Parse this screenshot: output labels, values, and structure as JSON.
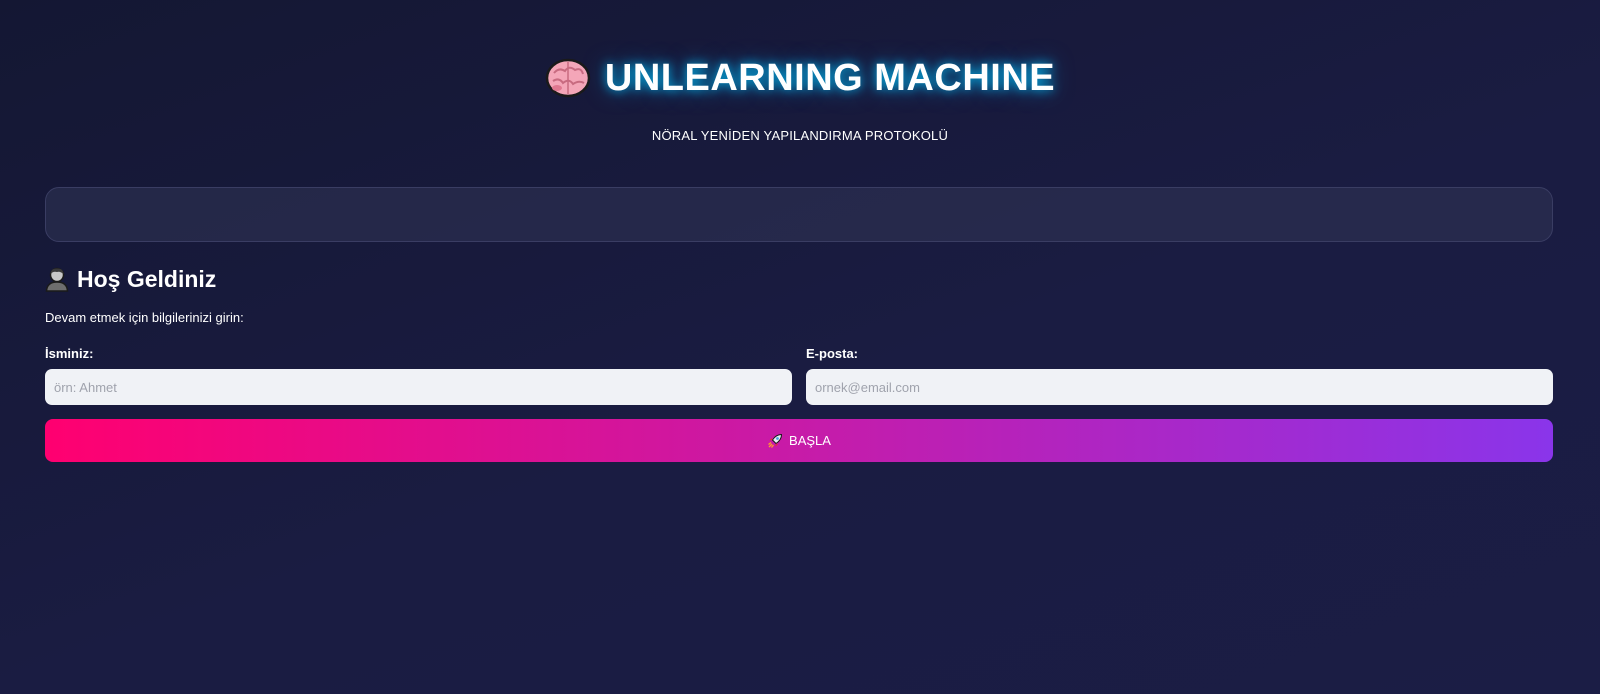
{
  "header": {
    "title": "UNLEARNING MACHINE",
    "subtitle": "NÖRAL YENİDEN YAPILANDIRMA PROTOKOLÜ",
    "icon": "brain-icon"
  },
  "welcome": {
    "title": "Hoş Geldiniz",
    "icon": "person-icon",
    "instructions": "Devam etmek için bilgilerinizi girin:"
  },
  "form": {
    "name_label": "İsminiz:",
    "name_placeholder": "örn: Ahmet",
    "name_value": "",
    "email_label": "E-posta:",
    "email_placeholder": "ornek@email.com",
    "email_value": "",
    "submit_label": "BAŞLA",
    "submit_icon": "rocket-icon"
  },
  "colors": {
    "background": "#1a1c42",
    "title_glow": "#00c8ff",
    "button_gradient_start": "#ff0070",
    "button_gradient_end": "#8a35ea",
    "input_background": "#f0f2f6"
  }
}
